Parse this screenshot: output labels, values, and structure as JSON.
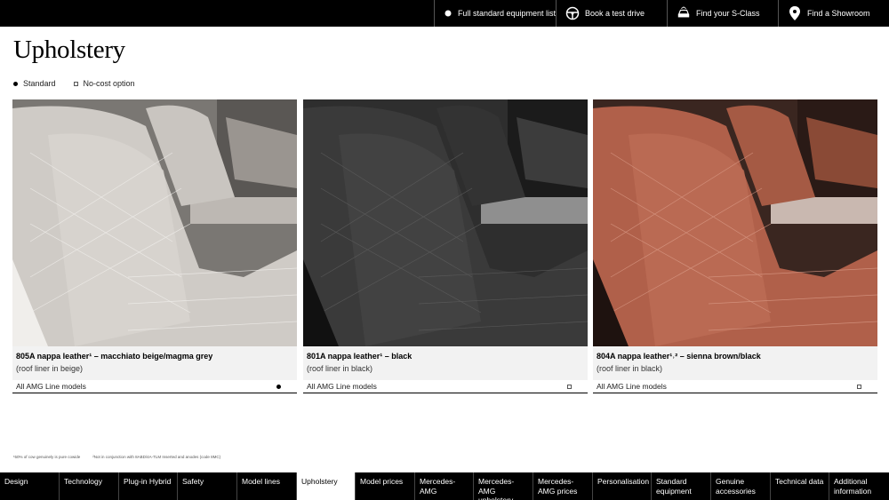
{
  "topnav": {
    "items": [
      {
        "label": "Full standard equipment list",
        "icon": "dot-icon"
      },
      {
        "label": "Book a test drive",
        "icon": "steering-wheel-icon"
      },
      {
        "label": "Find your S-Class",
        "icon": "car-search-icon"
      },
      {
        "label": "Find a Showroom",
        "icon": "location-pin-icon"
      }
    ]
  },
  "page": {
    "title": "Upholstery"
  },
  "legend": {
    "standard": "Standard",
    "no_cost": "No-cost option"
  },
  "cards": [
    {
      "title": "805A  nappa leather¹ – macchiato beige/magma grey",
      "subtitle": "(roof liner in beige)",
      "models": "All AMG Line models",
      "mark": "standard",
      "colors": {
        "seat": "#cfcbc6",
        "dark": "#8e8a86",
        "bg": "#6d6a67"
      }
    },
    {
      "title": "801A  nappa leather¹ – black",
      "subtitle": "(roof liner in black)",
      "models": "All AMG Line models",
      "mark": "no-cost",
      "colors": {
        "seat": "#3a3a3a",
        "dark": "#1a1a1a",
        "bg": "#2a2a2a"
      }
    },
    {
      "title": "804A  nappa leather¹˒² – sienna brown/black",
      "subtitle": "(roof liner in black)",
      "models": "All AMG Line models",
      "mark": "no-cost",
      "colors": {
        "seat": "#b0604a",
        "dark": "#7a3a2a",
        "bg": "#3a2620"
      }
    }
  ],
  "footnotes": [
    "¹50% of cow genuinely is pure cowide",
    "²Not in conjunction with 8ABD/4A-TLM Inserted and anodes (code 8MC)"
  ],
  "bottomnav": {
    "items": [
      {
        "label": "Design",
        "active": false
      },
      {
        "label": "Technology",
        "active": false
      },
      {
        "label": "Plug-in Hybrid",
        "active": false
      },
      {
        "label": "Safety",
        "active": false
      },
      {
        "label": "Model lines",
        "active": false
      },
      {
        "label": "Upholstery",
        "active": true
      },
      {
        "label": "Model prices",
        "active": false
      },
      {
        "label": "Mercedes-AMG",
        "active": false
      },
      {
        "label": "Mercedes-AMG upholstery",
        "active": false
      },
      {
        "label": "Mercedes-AMG prices",
        "active": false
      },
      {
        "label": "Personalisation",
        "active": false
      },
      {
        "label": "Standard equipment",
        "active": false
      },
      {
        "label": "Genuine accessories",
        "active": false
      },
      {
        "label": "Technical data",
        "active": false
      },
      {
        "label": "Additional information",
        "active": false
      }
    ]
  }
}
